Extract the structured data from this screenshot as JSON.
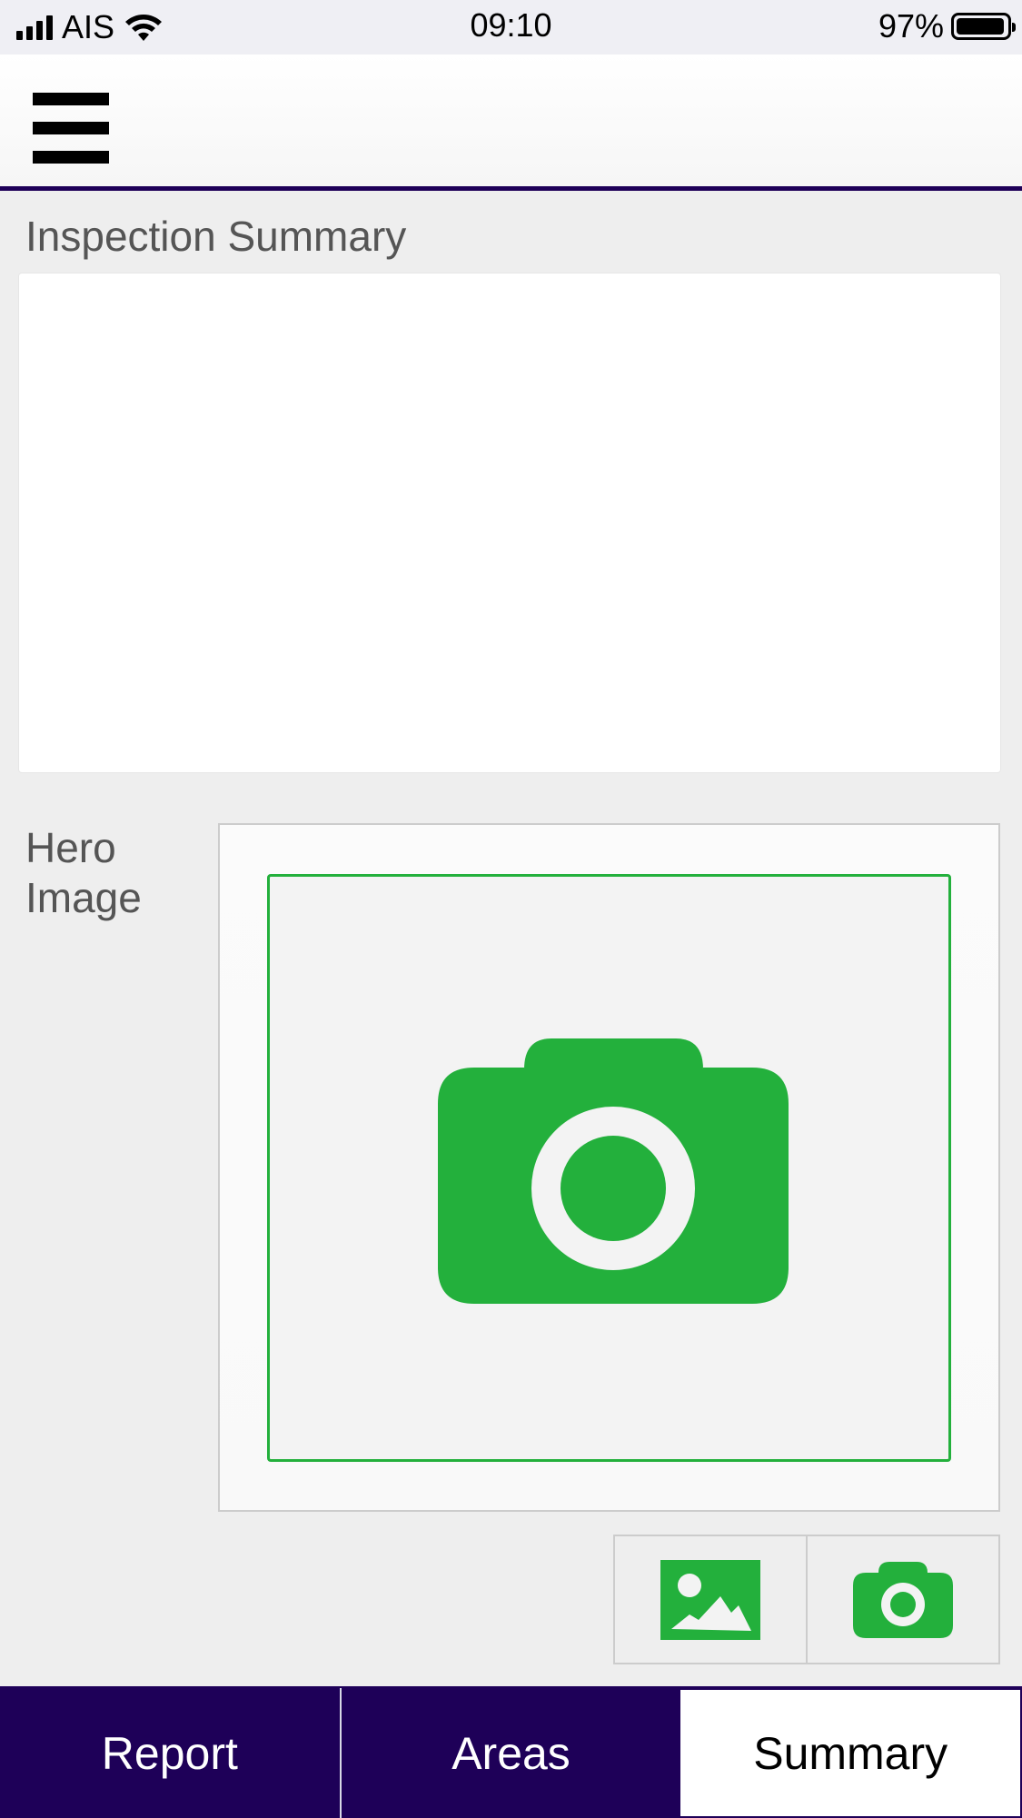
{
  "status_bar": {
    "carrier": "AIS",
    "time": "09:10",
    "battery_percent": "97%",
    "battery_level": 0.97,
    "icons": [
      "signal-icon",
      "wifi-icon",
      "battery-icon"
    ]
  },
  "header": {
    "menu_icon": "hamburger-menu-icon"
  },
  "summary": {
    "label": "Inspection Summary",
    "value": ""
  },
  "hero": {
    "label": "Hero Image",
    "placeholder_icon": "camera-icon"
  },
  "buttons": {
    "gallery_icon": "image-gallery-icon",
    "camera_icon": "camera-icon"
  },
  "tabs": [
    {
      "label": "Report",
      "active": false
    },
    {
      "label": "Areas",
      "active": false
    },
    {
      "label": "Summary",
      "active": true
    }
  ],
  "colors": {
    "brand_dark": "#1e0058",
    "accent_green": "#23b03c",
    "background": "#eeeeee"
  }
}
